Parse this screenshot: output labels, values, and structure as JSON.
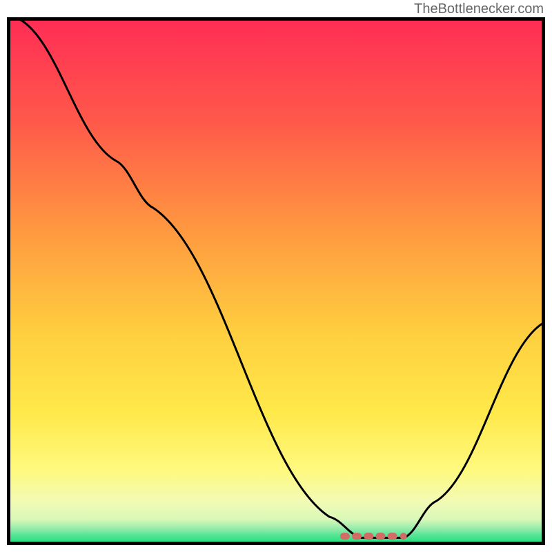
{
  "watermark": "TheBottlenecker.com",
  "chart_data": {
    "type": "line",
    "title": "",
    "xlabel": "",
    "ylabel": "",
    "xlim": [
      0,
      100
    ],
    "ylim": [
      0,
      100
    ],
    "gradient_top_color": "#ff2d55",
    "gradient_mid1_color": "#ff9933",
    "gradient_mid2_color": "#ffe94a",
    "gradient_mid3_color": "#f9fca8",
    "gradient_bottom_color": "#1fe07a",
    "curve": [
      {
        "x": 2,
        "y": 100
      },
      {
        "x": 20,
        "y": 73
      },
      {
        "x": 27,
        "y": 64
      },
      {
        "x": 60,
        "y": 5
      },
      {
        "x": 66,
        "y": 1
      },
      {
        "x": 74,
        "y": 1
      },
      {
        "x": 80,
        "y": 8
      },
      {
        "x": 100,
        "y": 42
      }
    ],
    "marker_segment": {
      "x_start": 62,
      "x_end": 74.5,
      "y": 1.3,
      "color": "#d36a63"
    },
    "frame_color": "#000000",
    "frame_width": 5
  }
}
